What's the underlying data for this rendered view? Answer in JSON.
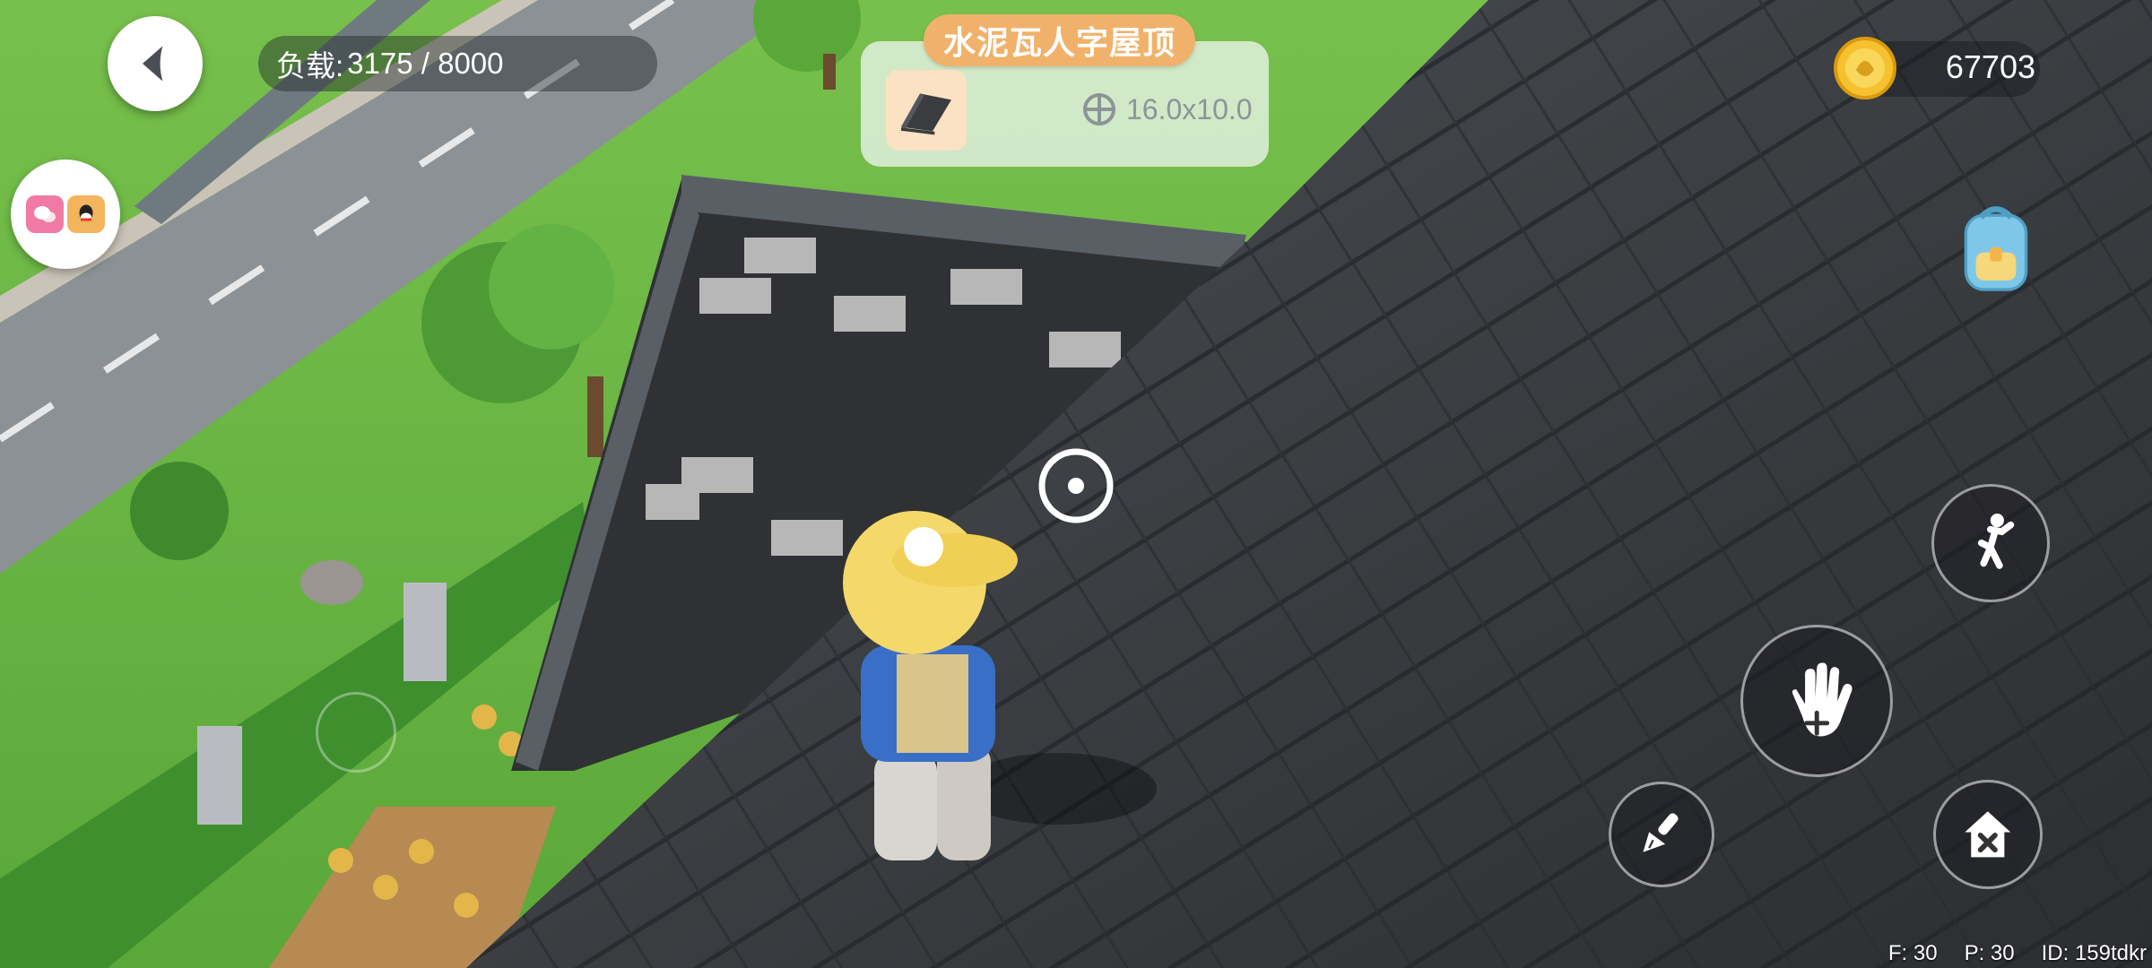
{
  "hud": {
    "load_label": "负载:",
    "load_value": "3175 / 8000",
    "coins": "67703"
  },
  "item": {
    "title": "水泥瓦人字屋顶",
    "size": "16.0x10.0",
    "icon": "roof-icon"
  },
  "actions": [
    {
      "name": "jump-button",
      "icon": "jump-icon"
    },
    {
      "name": "grab-move-button",
      "icon": "hand-move-icon"
    },
    {
      "name": "brush-button",
      "icon": "paint-brush-icon"
    },
    {
      "name": "remove-house-button",
      "icon": "house-remove-icon"
    }
  ],
  "debug": {
    "fps": "F: 30",
    "ping": "P: 30",
    "id": "ID: 159tdkr"
  },
  "colors": {
    "accent_orange": "#f0b26a",
    "roof_dark": "#3a3c40",
    "grass": "#6fc04a",
    "coin": "#f5c12e"
  }
}
